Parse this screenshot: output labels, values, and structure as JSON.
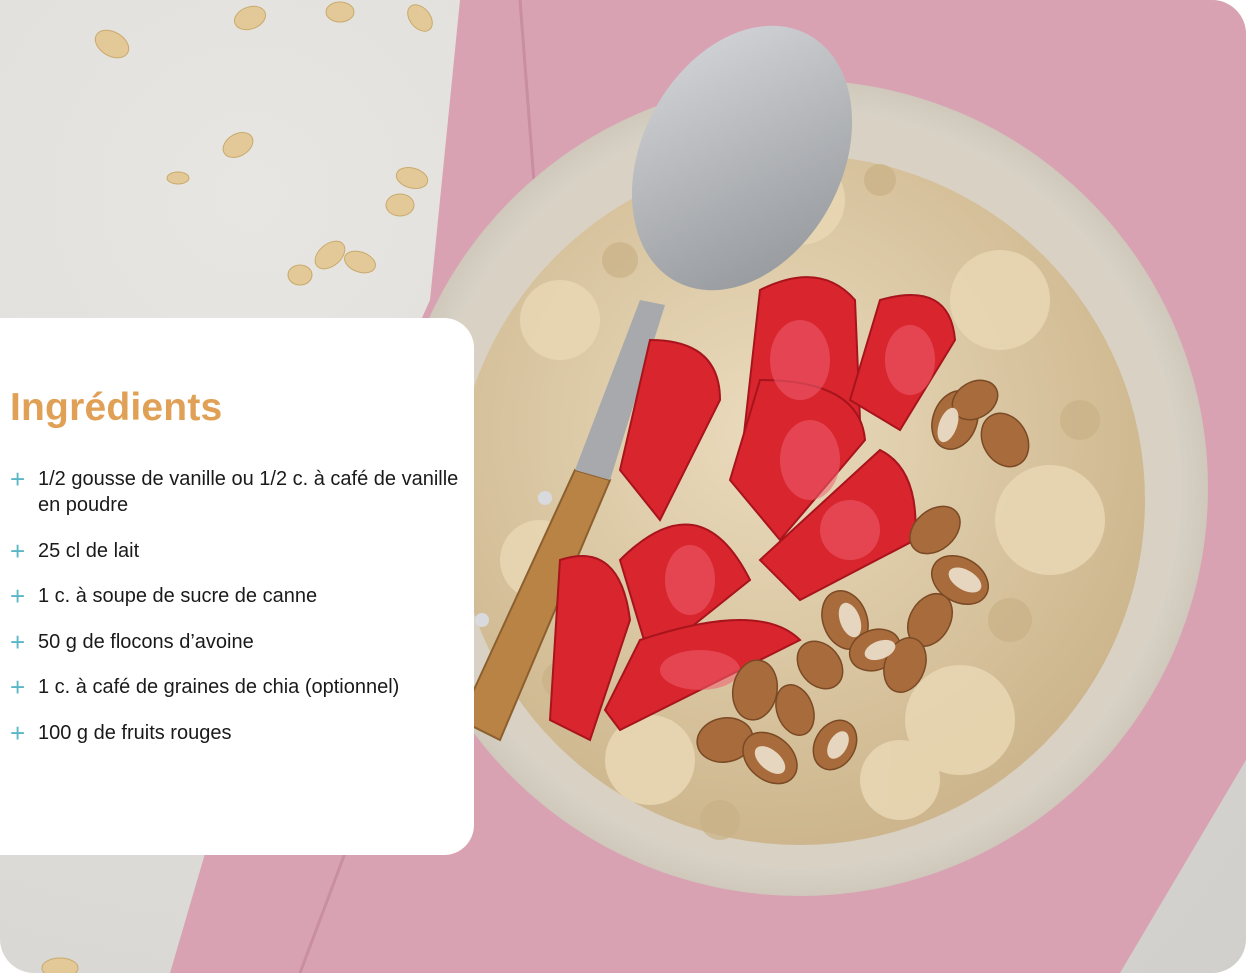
{
  "card": {
    "title": "Ingrédients",
    "items": [
      {
        "icon": "plus-icon",
        "text": "1/2 gousse de vanille ou 1/2 c. à café de vanille en poudre"
      },
      {
        "icon": "plus-icon",
        "text": "25 cl de lait"
      },
      {
        "icon": "plus-icon",
        "text": "1 c. à soupe de sucre de canne"
      },
      {
        "icon": "plus-icon",
        "text": "50 g de flocons d’avoine"
      },
      {
        "icon": "plus-icon",
        "text": "1 c. à café de graines de chia (optionnel)"
      },
      {
        "icon": "plus-icon",
        "text": "100 g de fruits rouges"
      }
    ]
  },
  "colors": {
    "title": "#e0a055",
    "bullet": "#5ab7c7",
    "text": "#1a1a1a",
    "card_bg": "#ffffff",
    "countertop": "#dcdad6",
    "napkin": "#d8a2b3",
    "bowl": "#e2ddd3",
    "porridge": "#dcc8a2",
    "strawberry": "#d8252e",
    "almond": "#a86b3c",
    "spoon": "#aeb0b3",
    "spoon_handle": "#b98345"
  }
}
